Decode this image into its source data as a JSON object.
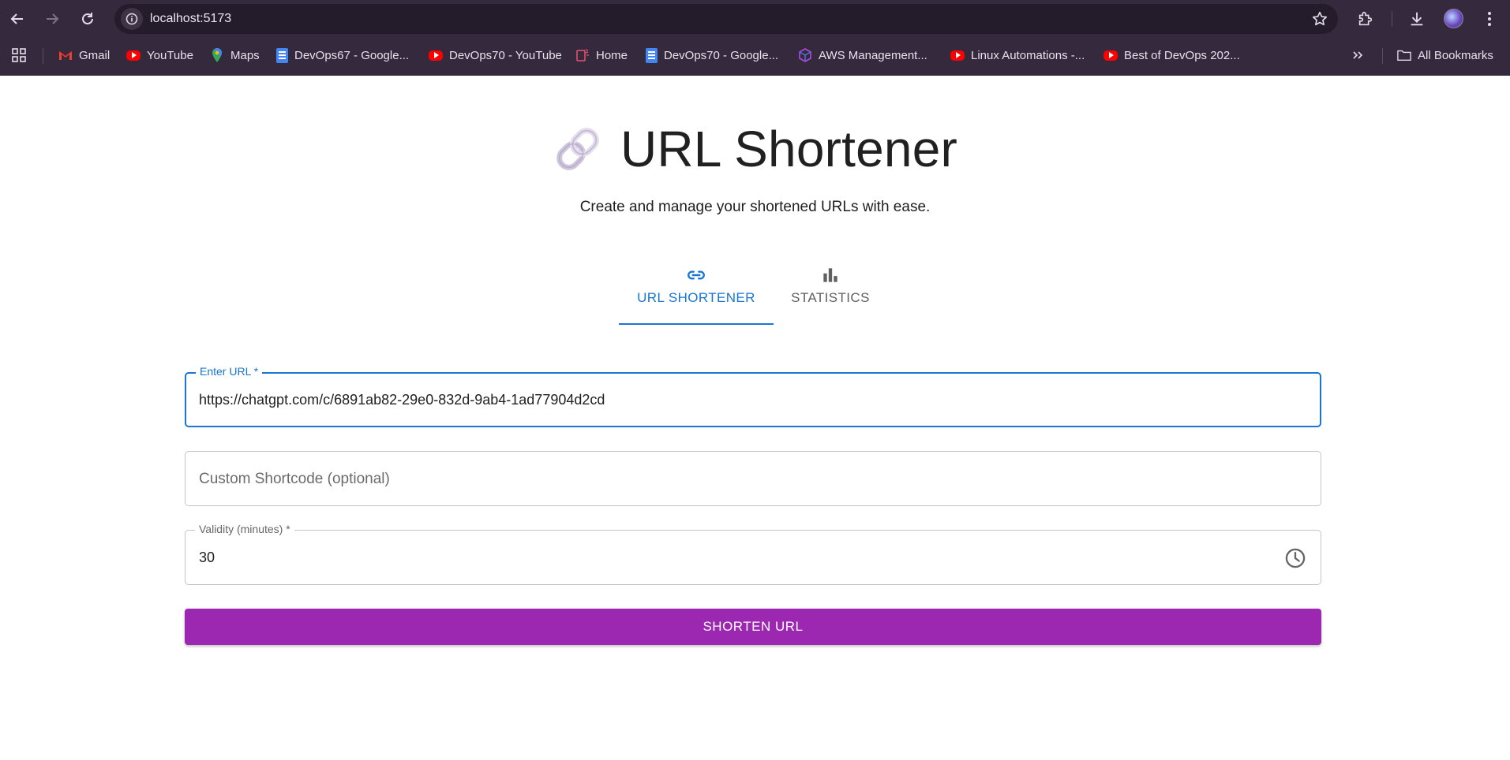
{
  "browser": {
    "url": "localhost:5173",
    "bookmarks": [
      {
        "label": "Gmail",
        "icon": "gmail-icon"
      },
      {
        "label": "YouTube",
        "icon": "youtube-icon"
      },
      {
        "label": "Maps",
        "icon": "maps-icon"
      },
      {
        "label": "DevOps67 - Google...",
        "icon": "google-docs-icon"
      },
      {
        "label": "DevOps70 - YouTube",
        "icon": "youtube-icon"
      },
      {
        "label": "Home",
        "icon": "home-icon"
      },
      {
        "label": "DevOps70 - Google...",
        "icon": "google-docs-icon"
      },
      {
        "label": "AWS Management...",
        "icon": "aws-cube-icon"
      },
      {
        "label": "Linux Automations -...",
        "icon": "youtube-icon"
      },
      {
        "label": "Best of DevOps 202...",
        "icon": "youtube-icon"
      }
    ],
    "all_bookmarks_label": "All Bookmarks"
  },
  "app": {
    "title": "URL Shortener",
    "subtitle": "Create and manage your shortened URLs with ease.",
    "tabs": [
      {
        "label": "URL SHORTENER",
        "icon": "link-icon",
        "active": true
      },
      {
        "label": "STATISTICS",
        "icon": "bar-chart-icon",
        "active": false
      }
    ],
    "form": {
      "url_label": "Enter URL *",
      "url_value": "https://chatgpt.com/c/6891ab82-29e0-832d-9ab4-1ad77904d2cd",
      "shortcode_placeholder": "Custom Shortcode (optional)",
      "validity_label": "Validity (minutes) *",
      "validity_value": "30",
      "submit_label": "SHORTEN URL"
    }
  },
  "colors": {
    "chrome_bg": "#35293d",
    "primary_blue": "#1976d2",
    "button_purple": "#9c27b0"
  }
}
